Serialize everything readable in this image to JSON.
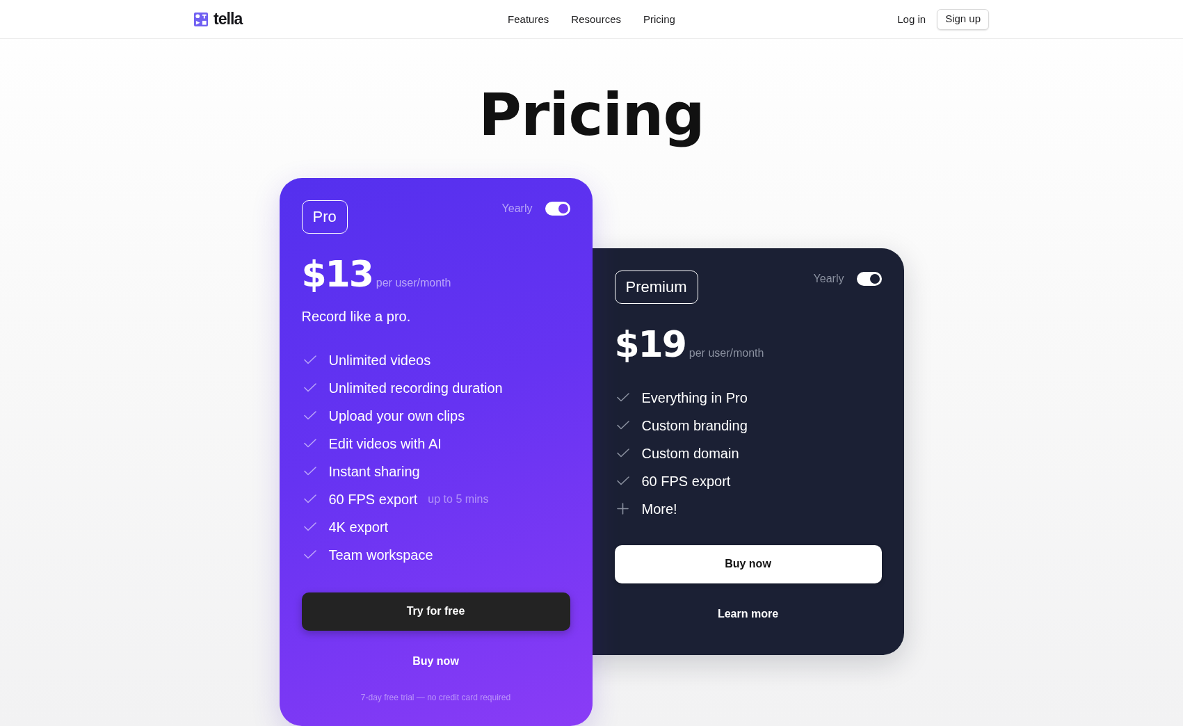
{
  "header": {
    "logo": "tella",
    "nav": [
      {
        "label": "Features"
      },
      {
        "label": "Resources"
      },
      {
        "label": "Pricing"
      }
    ],
    "actions": [
      {
        "kind": "link",
        "label": "Log in"
      },
      {
        "kind": "outlined",
        "label": "Sign up"
      }
    ]
  },
  "heading": "Pricing",
  "plans": [
    {
      "kind": "gradient",
      "name": "Pro",
      "billing": {
        "label": "Yearly",
        "on": true
      },
      "price": "$13",
      "unit": "per user/month",
      "tagline": "Record like a pro.",
      "features": [
        {
          "kind": "check",
          "label": "Unlimited videos"
        },
        {
          "kind": "check",
          "label": "Unlimited recording duration"
        },
        {
          "kind": "check",
          "label": "Upload your own clips"
        },
        {
          "kind": "check",
          "label": "Edit videos with AI"
        },
        {
          "kind": "check",
          "label": "Instant sharing"
        },
        {
          "kind": "check",
          "label": "60 FPS export",
          "note": "up to 5 mins"
        },
        {
          "kind": "check",
          "label": "4K export"
        },
        {
          "kind": "check",
          "label": "Team workspace"
        }
      ],
      "buttons": [
        {
          "kind": "solid",
          "label": "Try for free"
        },
        {
          "kind": "text",
          "label": "Buy now"
        }
      ],
      "footnote": "7-day free trial — no credit card required"
    },
    {
      "kind": "dark",
      "name": "Premium",
      "billing": {
        "label": "Yearly",
        "on": true
      },
      "price": "$19",
      "unit": "per user/month",
      "features": [
        {
          "kind": "check",
          "label": "Everything in Pro"
        },
        {
          "kind": "check",
          "label": "Custom branding"
        },
        {
          "kind": "check",
          "label": "Custom domain"
        },
        {
          "kind": "check",
          "label": "60 FPS export"
        },
        {
          "kind": "plus",
          "label": "More!"
        }
      ],
      "buttons": [
        {
          "kind": "light",
          "label": "Buy now"
        },
        {
          "kind": "text",
          "label": "Learn more"
        }
      ]
    }
  ]
}
